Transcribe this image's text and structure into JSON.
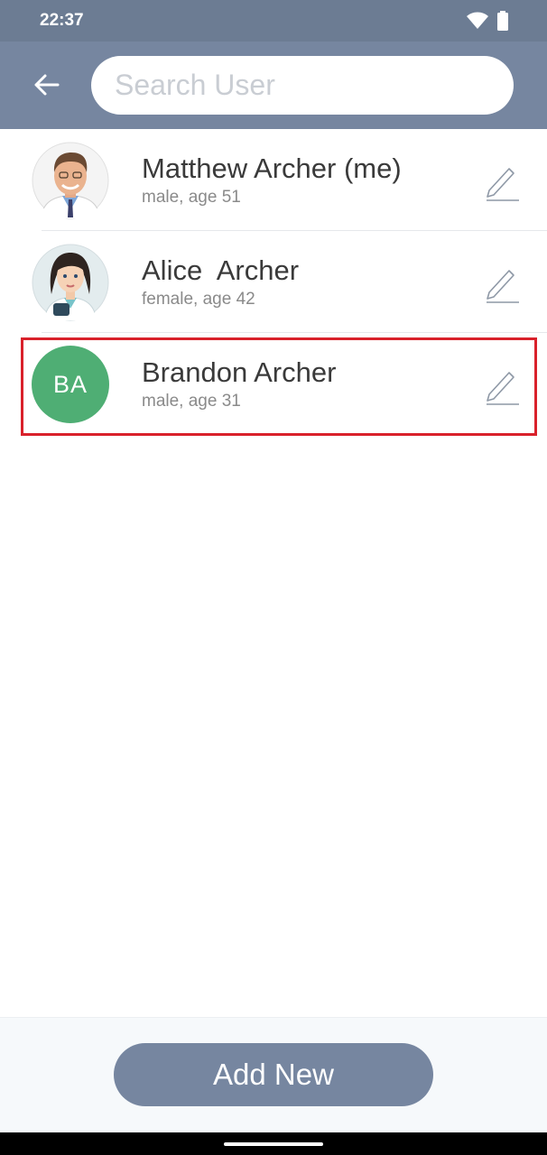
{
  "status_bar": {
    "time": "22:37"
  },
  "header": {
    "search": {
      "placeholder": "Search User",
      "value": ""
    }
  },
  "users": [
    {
      "name": "Matthew Archer (me)",
      "subtitle": "male, age 51",
      "avatar": "photo-man-doctor"
    },
    {
      "name": "Alice  Archer",
      "subtitle": "female, age 42",
      "avatar": "illustration-woman-doctor"
    },
    {
      "name": "Brandon Archer",
      "subtitle": "male, age 31",
      "initials": "BA",
      "avatar_color": "#4fae74"
    }
  ],
  "footer": {
    "add_label": "Add New"
  },
  "colors": {
    "header": "#7686a0",
    "status_bar": "#6c7c93",
    "highlight": "#d9212b"
  }
}
